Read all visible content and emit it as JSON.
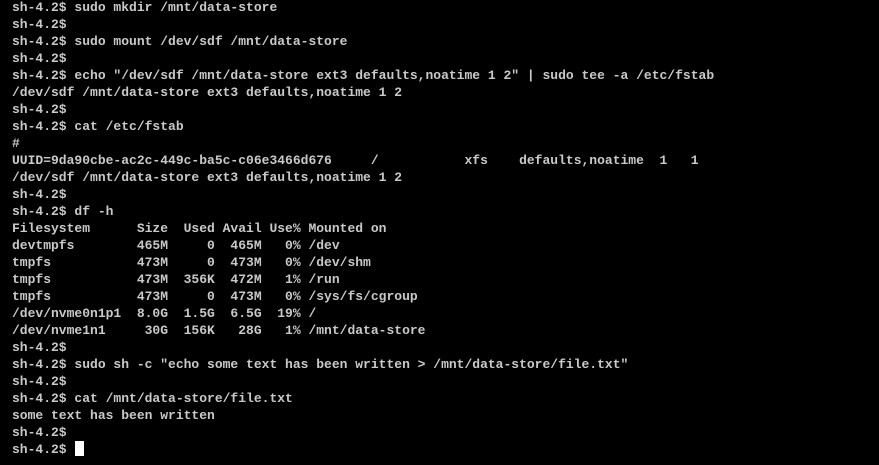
{
  "terminal": {
    "colors": {
      "background": "#000000",
      "text": "#c9c9c9",
      "cursor": "#ffffff"
    },
    "prompt": "sh-4.2$",
    "lines": [
      "sh-4.2$ sudo mkdir /mnt/data-store",
      "sh-4.2$",
      "sh-4.2$ sudo mount /dev/sdf /mnt/data-store",
      "sh-4.2$",
      "sh-4.2$ echo \"/dev/sdf /mnt/data-store ext3 defaults,noatime 1 2\" | sudo tee -a /etc/fstab",
      "/dev/sdf /mnt/data-store ext3 defaults,noatime 1 2",
      "sh-4.2$",
      "sh-4.2$ cat /etc/fstab",
      "#",
      "UUID=9da90cbe-ac2c-449c-ba5c-c06e3466d676     /           xfs    defaults,noatime  1   1",
      "/dev/sdf /mnt/data-store ext3 defaults,noatime 1 2",
      "sh-4.2$",
      "sh-4.2$ df -h",
      "Filesystem      Size  Used Avail Use% Mounted on",
      "devtmpfs        465M     0  465M   0% /dev",
      "tmpfs           473M     0  473M   0% /dev/shm",
      "tmpfs           473M  356K  472M   1% /run",
      "tmpfs           473M     0  473M   0% /sys/fs/cgroup",
      "/dev/nvme0n1p1  8.0G  1.5G  6.5G  19% /",
      "/dev/nvme1n1     30G  156K   28G   1% /mnt/data-store",
      "sh-4.2$",
      "sh-4.2$ sudo sh -c \"echo some text has been written > /mnt/data-store/file.txt\"",
      "sh-4.2$",
      "sh-4.2$ cat /mnt/data-store/file.txt",
      "some text has been written",
      "sh-4.2$",
      "sh-4.2$ "
    ]
  }
}
